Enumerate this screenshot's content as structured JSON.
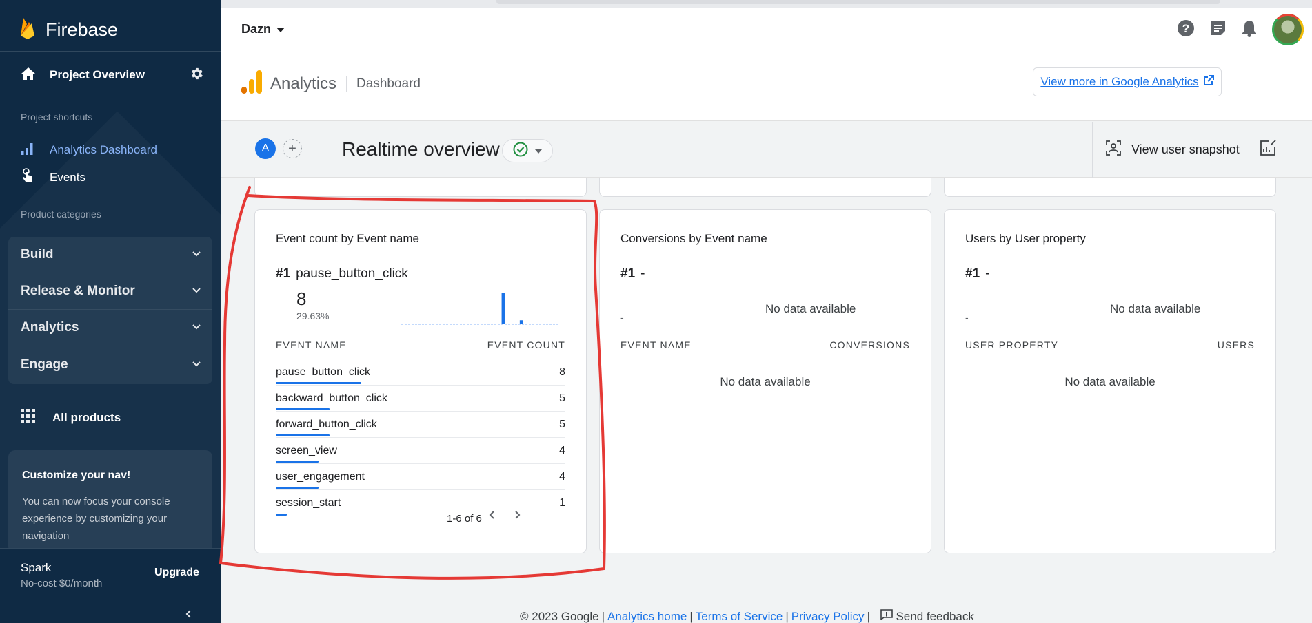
{
  "sidebar": {
    "brand": "Firebase",
    "project_overview": "Project Overview",
    "shortcuts_caption": "Project shortcuts",
    "shortcuts": [
      {
        "label": "Analytics Dashboard"
      },
      {
        "label": "Events"
      }
    ],
    "categories_caption": "Product categories",
    "categories": [
      {
        "label": "Build"
      },
      {
        "label": "Release & Monitor"
      },
      {
        "label": "Analytics"
      },
      {
        "label": "Engage"
      }
    ],
    "all_products": "All products",
    "promo": {
      "title": "Customize your nav!",
      "body": "You can now focus your console experience by customizing your navigation"
    },
    "plan": {
      "name": "Spark",
      "price": "No-cost $0/month",
      "upgrade": "Upgrade"
    }
  },
  "header": {
    "project": "Dazn",
    "product": "Analytics",
    "page": "Dashboard",
    "ga_link": "View more in Google Analytics"
  },
  "subbar": {
    "comparison_chip": "A",
    "title": "Realtime overview",
    "snapshot": "View user snapshot"
  },
  "cards": {
    "events": {
      "title_metric": "Event count",
      "title_by": "by",
      "title_dimension": "Event name",
      "rank": "#1",
      "top_name": "pause_button_click",
      "top_value": "8",
      "top_pct": "29.63%",
      "col_name": "EVENT NAME",
      "col_value": "EVENT COUNT",
      "rows": [
        {
          "name": "pause_button_click",
          "value": "8",
          "share": 1.0
        },
        {
          "name": "backward_button_click",
          "value": "5",
          "share": 0.625
        },
        {
          "name": "forward_button_click",
          "value": "5",
          "share": 0.625
        },
        {
          "name": "screen_view",
          "value": "4",
          "share": 0.5
        },
        {
          "name": "user_engagement",
          "value": "4",
          "share": 0.5
        },
        {
          "name": "session_start",
          "value": "1",
          "share": 0.125
        }
      ],
      "pagination": "1-6 of 6",
      "sparkline": [
        0,
        0,
        0,
        0,
        0,
        0,
        0,
        0,
        0,
        0,
        0,
        0,
        0,
        0,
        0,
        0,
        0,
        0,
        0,
        0,
        0,
        0,
        8,
        0,
        0,
        0,
        1,
        0,
        0,
        0,
        0,
        0,
        0,
        0,
        0
      ]
    },
    "conversions": {
      "title_metric": "Conversions",
      "title_by": "by",
      "title_dimension": "Event name",
      "rank": "#1",
      "top_name": "-",
      "top_small": "-",
      "nodata_top": "No data available",
      "col_name": "EVENT NAME",
      "col_value": "CONVERSIONS",
      "nodata": "No data available"
    },
    "users": {
      "title_metric": "Users",
      "title_by": "by",
      "title_dimension": "User property",
      "rank": "#1",
      "top_name": "-",
      "top_small": "-",
      "nodata_top": "No data available",
      "col_name": "USER PROPERTY",
      "col_value": "USERS",
      "nodata": "No data available"
    }
  },
  "footer": {
    "copyright": "© 2023 Google",
    "links": [
      "Analytics home",
      "Terms of Service",
      "Privacy Policy"
    ],
    "feedback": "Send feedback"
  },
  "colors": {
    "sidebar_bg": "#0f2a44",
    "accent": "#1a73e8",
    "annotation": "#e53935",
    "success": "#1e8e3e"
  }
}
